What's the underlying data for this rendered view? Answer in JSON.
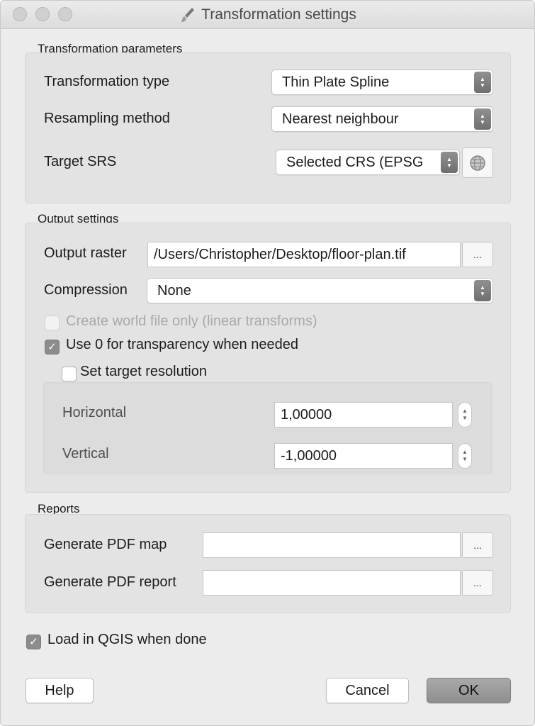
{
  "window": {
    "title": "Transformation settings"
  },
  "transformation": {
    "group_title": "Transformation parameters",
    "type_label": "Transformation type",
    "type_value": "Thin Plate Spline",
    "resampling_label": "Resampling method",
    "resampling_value": "Nearest neighbour",
    "target_srs_label": "Target SRS",
    "target_srs_value": "Selected CRS (EPSG"
  },
  "output": {
    "group_title": "Output settings",
    "raster_label": "Output raster",
    "raster_value": "/Users/Christopher/Desktop/floor-plan.tif",
    "browse_label": "...",
    "compression_label": "Compression",
    "compression_value": "None",
    "world_file_label": "Create world file only (linear transforms)",
    "world_file_checked": false,
    "world_file_enabled": false,
    "transparency_label": "Use 0 for transparency when needed",
    "transparency_checked": true,
    "resolution_label": "Set target resolution",
    "resolution_checked": false,
    "horizontal_label": "Horizontal",
    "horizontal_value": "1,00000",
    "vertical_label": "Vertical",
    "vertical_value": "-1,00000"
  },
  "reports": {
    "group_title": "Reports",
    "pdf_map_label": "Generate PDF map",
    "pdf_map_value": "",
    "pdf_report_label": "Generate PDF report",
    "pdf_report_value": "",
    "browse_label": "..."
  },
  "load_in_qgis": {
    "label": "Load in QGIS when done",
    "checked": true
  },
  "buttons": {
    "help": "Help",
    "cancel": "Cancel",
    "ok": "OK"
  },
  "check_glyph": "✓",
  "colors": {
    "window_bg": "#ececec",
    "group_bg": "#e3e3e3",
    "checked_box": "#8c8c8c",
    "default_button": "#9c9c9c"
  },
  "icons": {
    "title": "brush-icon",
    "crs_selector": "globe-icon",
    "combo_arrows": "chevron-updown-icon",
    "spinner": "spinbox-arrows-icon"
  }
}
